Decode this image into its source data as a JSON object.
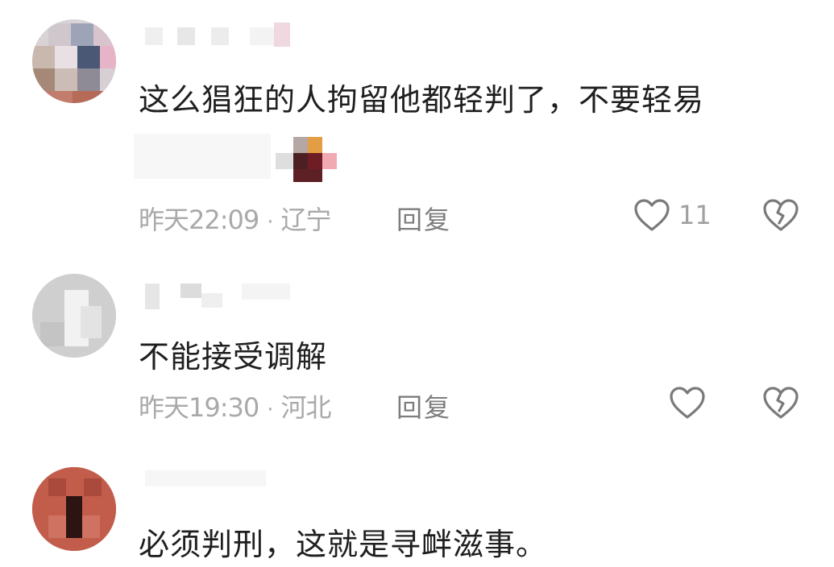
{
  "comments": [
    {
      "text": "这么猖狂的人拘留他都轻判了，不要轻易",
      "time": "昨天22:09",
      "location": "辽宁",
      "reply_label": "回复",
      "likes": "11"
    },
    {
      "text": "不能接受调解",
      "time": "昨天19:30",
      "location": "河北",
      "reply_label": "回复",
      "likes": ""
    },
    {
      "text": "必须判刑，这就是寻衅滋事。"
    }
  ],
  "meta_separator": "·",
  "icons": {
    "like": "heart-outline-icon",
    "dislike": "broken-heart-icon"
  },
  "colors": {
    "text": "#1f1f1f",
    "meta": "#a9a9a9",
    "reply": "#7d7d7d",
    "icon": "#7a7a7a"
  }
}
